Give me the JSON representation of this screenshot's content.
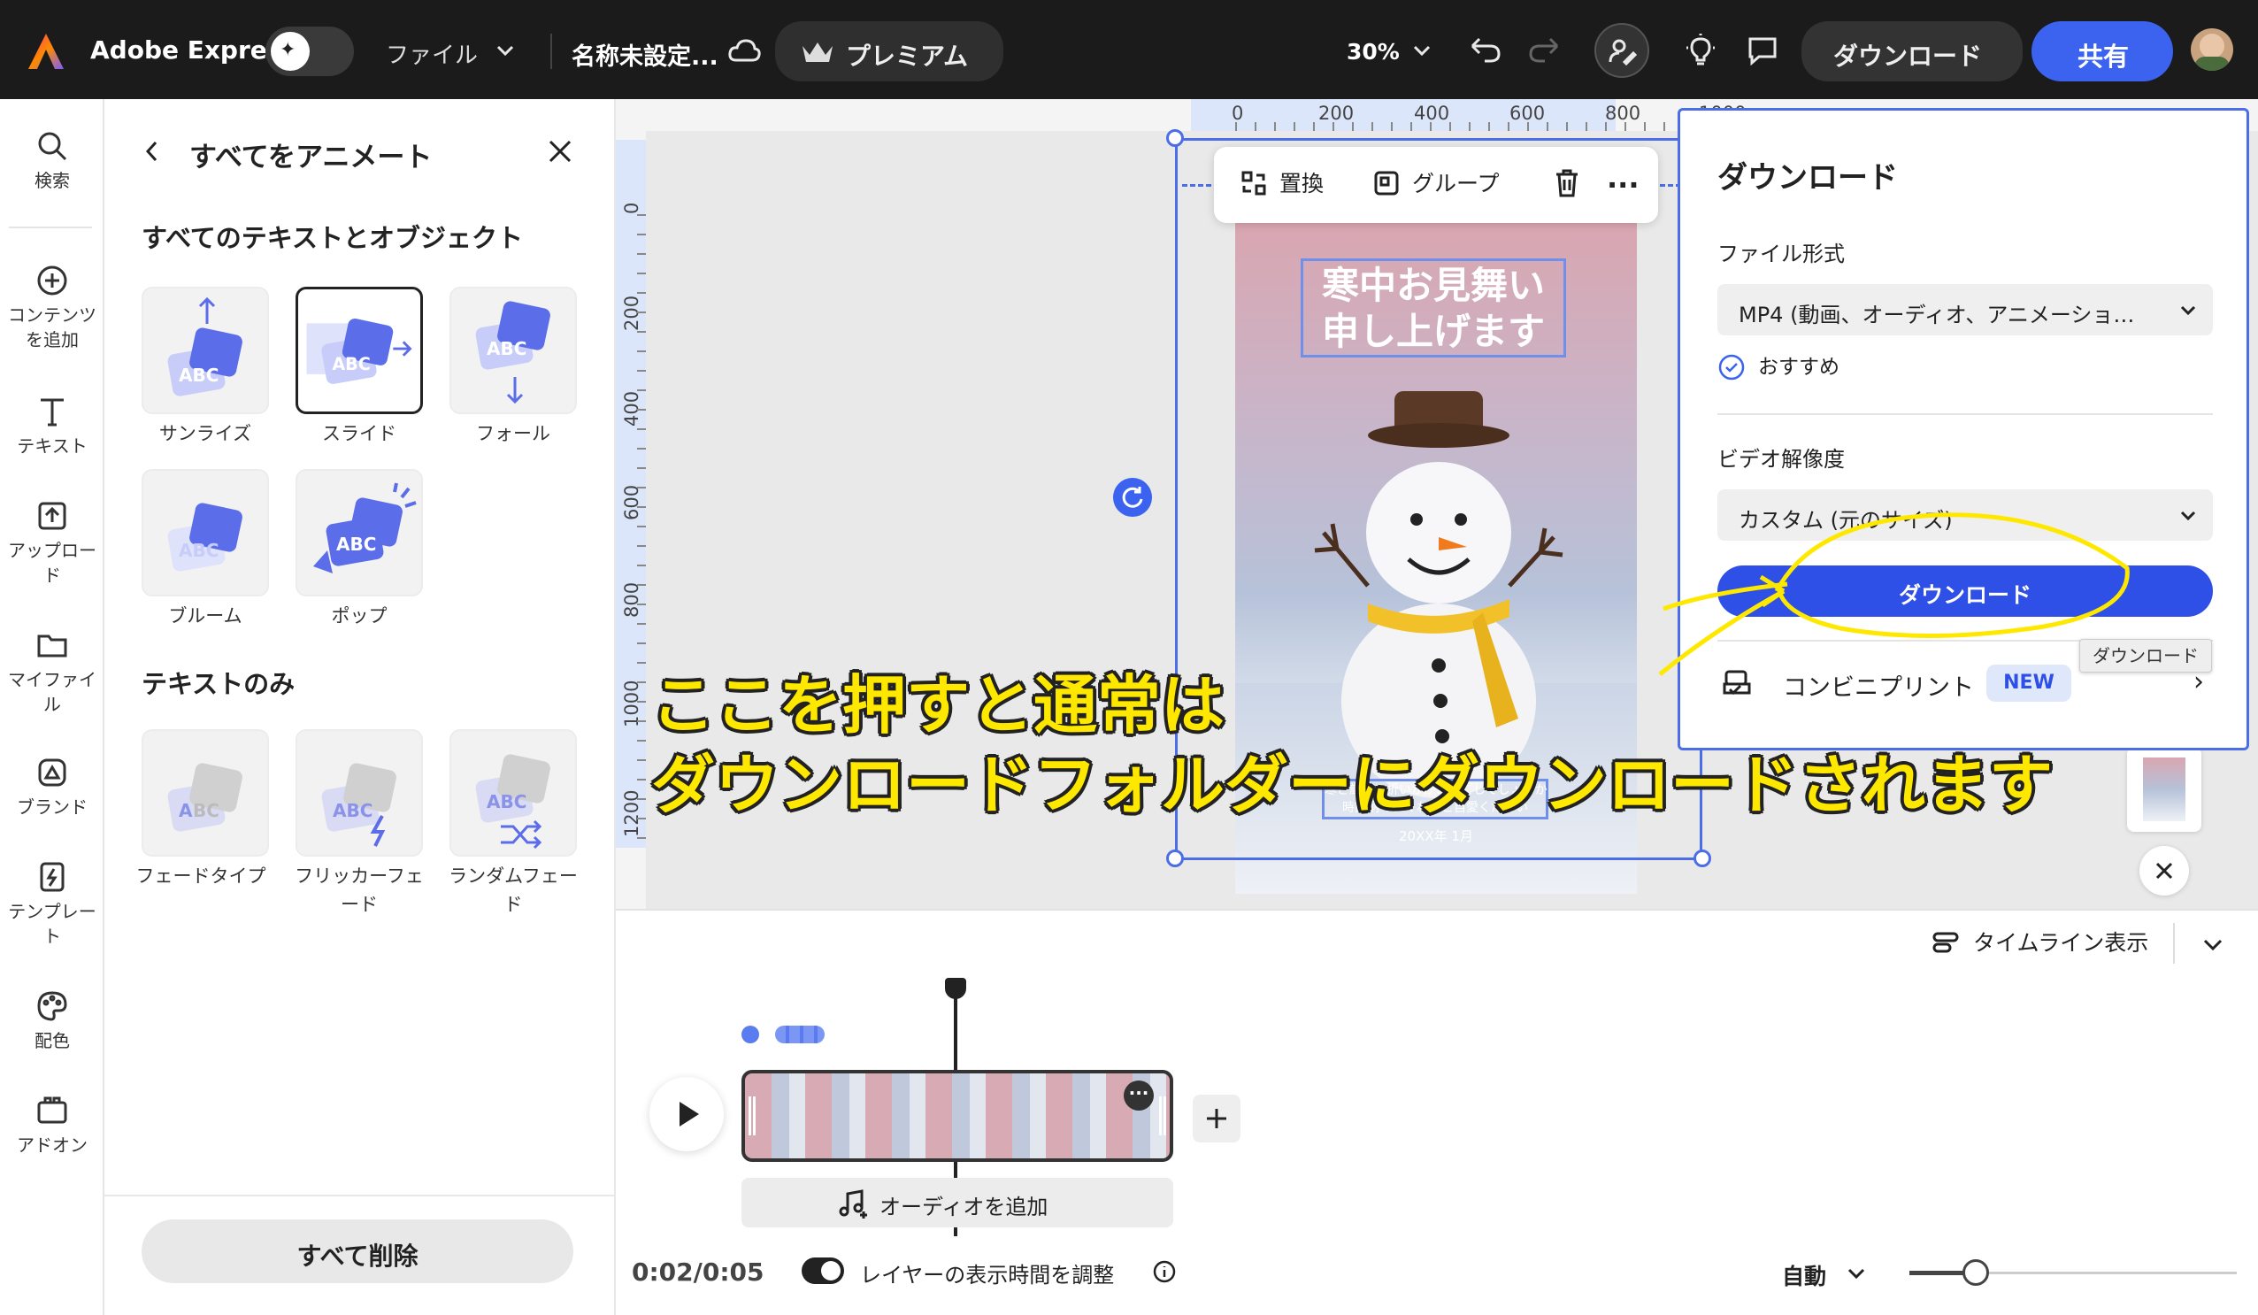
{
  "topbar": {
    "app_name": "Adobe Express",
    "file_menu": "ファイル",
    "doc_title": "名称未設定...",
    "premium": "プレミアム",
    "zoom": "30%",
    "download": "ダウンロード",
    "share": "共有"
  },
  "rail": {
    "items": [
      {
        "label": "検索"
      },
      {
        "label": "コンテンツを追加"
      },
      {
        "label": "テキスト"
      },
      {
        "label": "アップロード"
      },
      {
        "label": "マイファイル"
      },
      {
        "label": "ブランド"
      },
      {
        "label": "テンプレート"
      },
      {
        "label": "配色"
      },
      {
        "label": "アドオン"
      }
    ]
  },
  "panel": {
    "title": "すべてをアニメート",
    "section1": "すべてのテキストとオブジェクト",
    "section2": "テキストのみ",
    "tiles1": [
      {
        "label": "サンライズ"
      },
      {
        "label": "スライド"
      },
      {
        "label": "フォール"
      },
      {
        "label": "ブルーム"
      },
      {
        "label": "ポップ"
      }
    ],
    "tiles2": [
      {
        "label": "フェードタイプ"
      },
      {
        "label": "フリッカーフェード"
      },
      {
        "label": "ランダムフェード"
      }
    ],
    "delete_all": "すべて削除"
  },
  "canvas": {
    "toolbar": {
      "replace": "置換",
      "group": "グループ"
    },
    "ruler_x": [
      "0",
      "200",
      "400",
      "600",
      "800",
      "1000"
    ],
    "ruler_y": [
      "0",
      "200",
      "400",
      "600",
      "800",
      "1000",
      "1200"
    ],
    "card": {
      "title_line1": "寒中お見舞い",
      "title_line2": "申し上げます",
      "body_line1": "寒さ厳しい折いかがお過ごしでしょうか",
      "body_line2": "時節柄くれぐれもご自愛ください",
      "date": "20XX年 1月"
    }
  },
  "download_panel": {
    "title": "ダウンロード",
    "format_label": "ファイル形式",
    "format_value": "MP4 (動画、オーディオ、アニメーショ…",
    "recommended": "おすすめ",
    "resolution_label": "ビデオ解像度",
    "resolution_value": "カスタム (元のサイズ)",
    "download_button": "ダウンロード",
    "convenience_print": "コンビニプリント",
    "new_badge": "NEW",
    "tooltip": "ダウンロード"
  },
  "annotation": {
    "line1": "ここを押すと通常は",
    "line2": "ダウンロードフォルダーにダウンロードされます"
  },
  "timeline": {
    "view_label": "タイムライン表示",
    "add_audio": "オーディオを追加",
    "time": "0:02/0:05",
    "adjust_label": "レイヤーの表示時間を調整",
    "auto": "自動"
  },
  "colors": {
    "accent": "#3b63f0",
    "annotation": "#ffe800",
    "topbar": "#1b1b1b"
  }
}
